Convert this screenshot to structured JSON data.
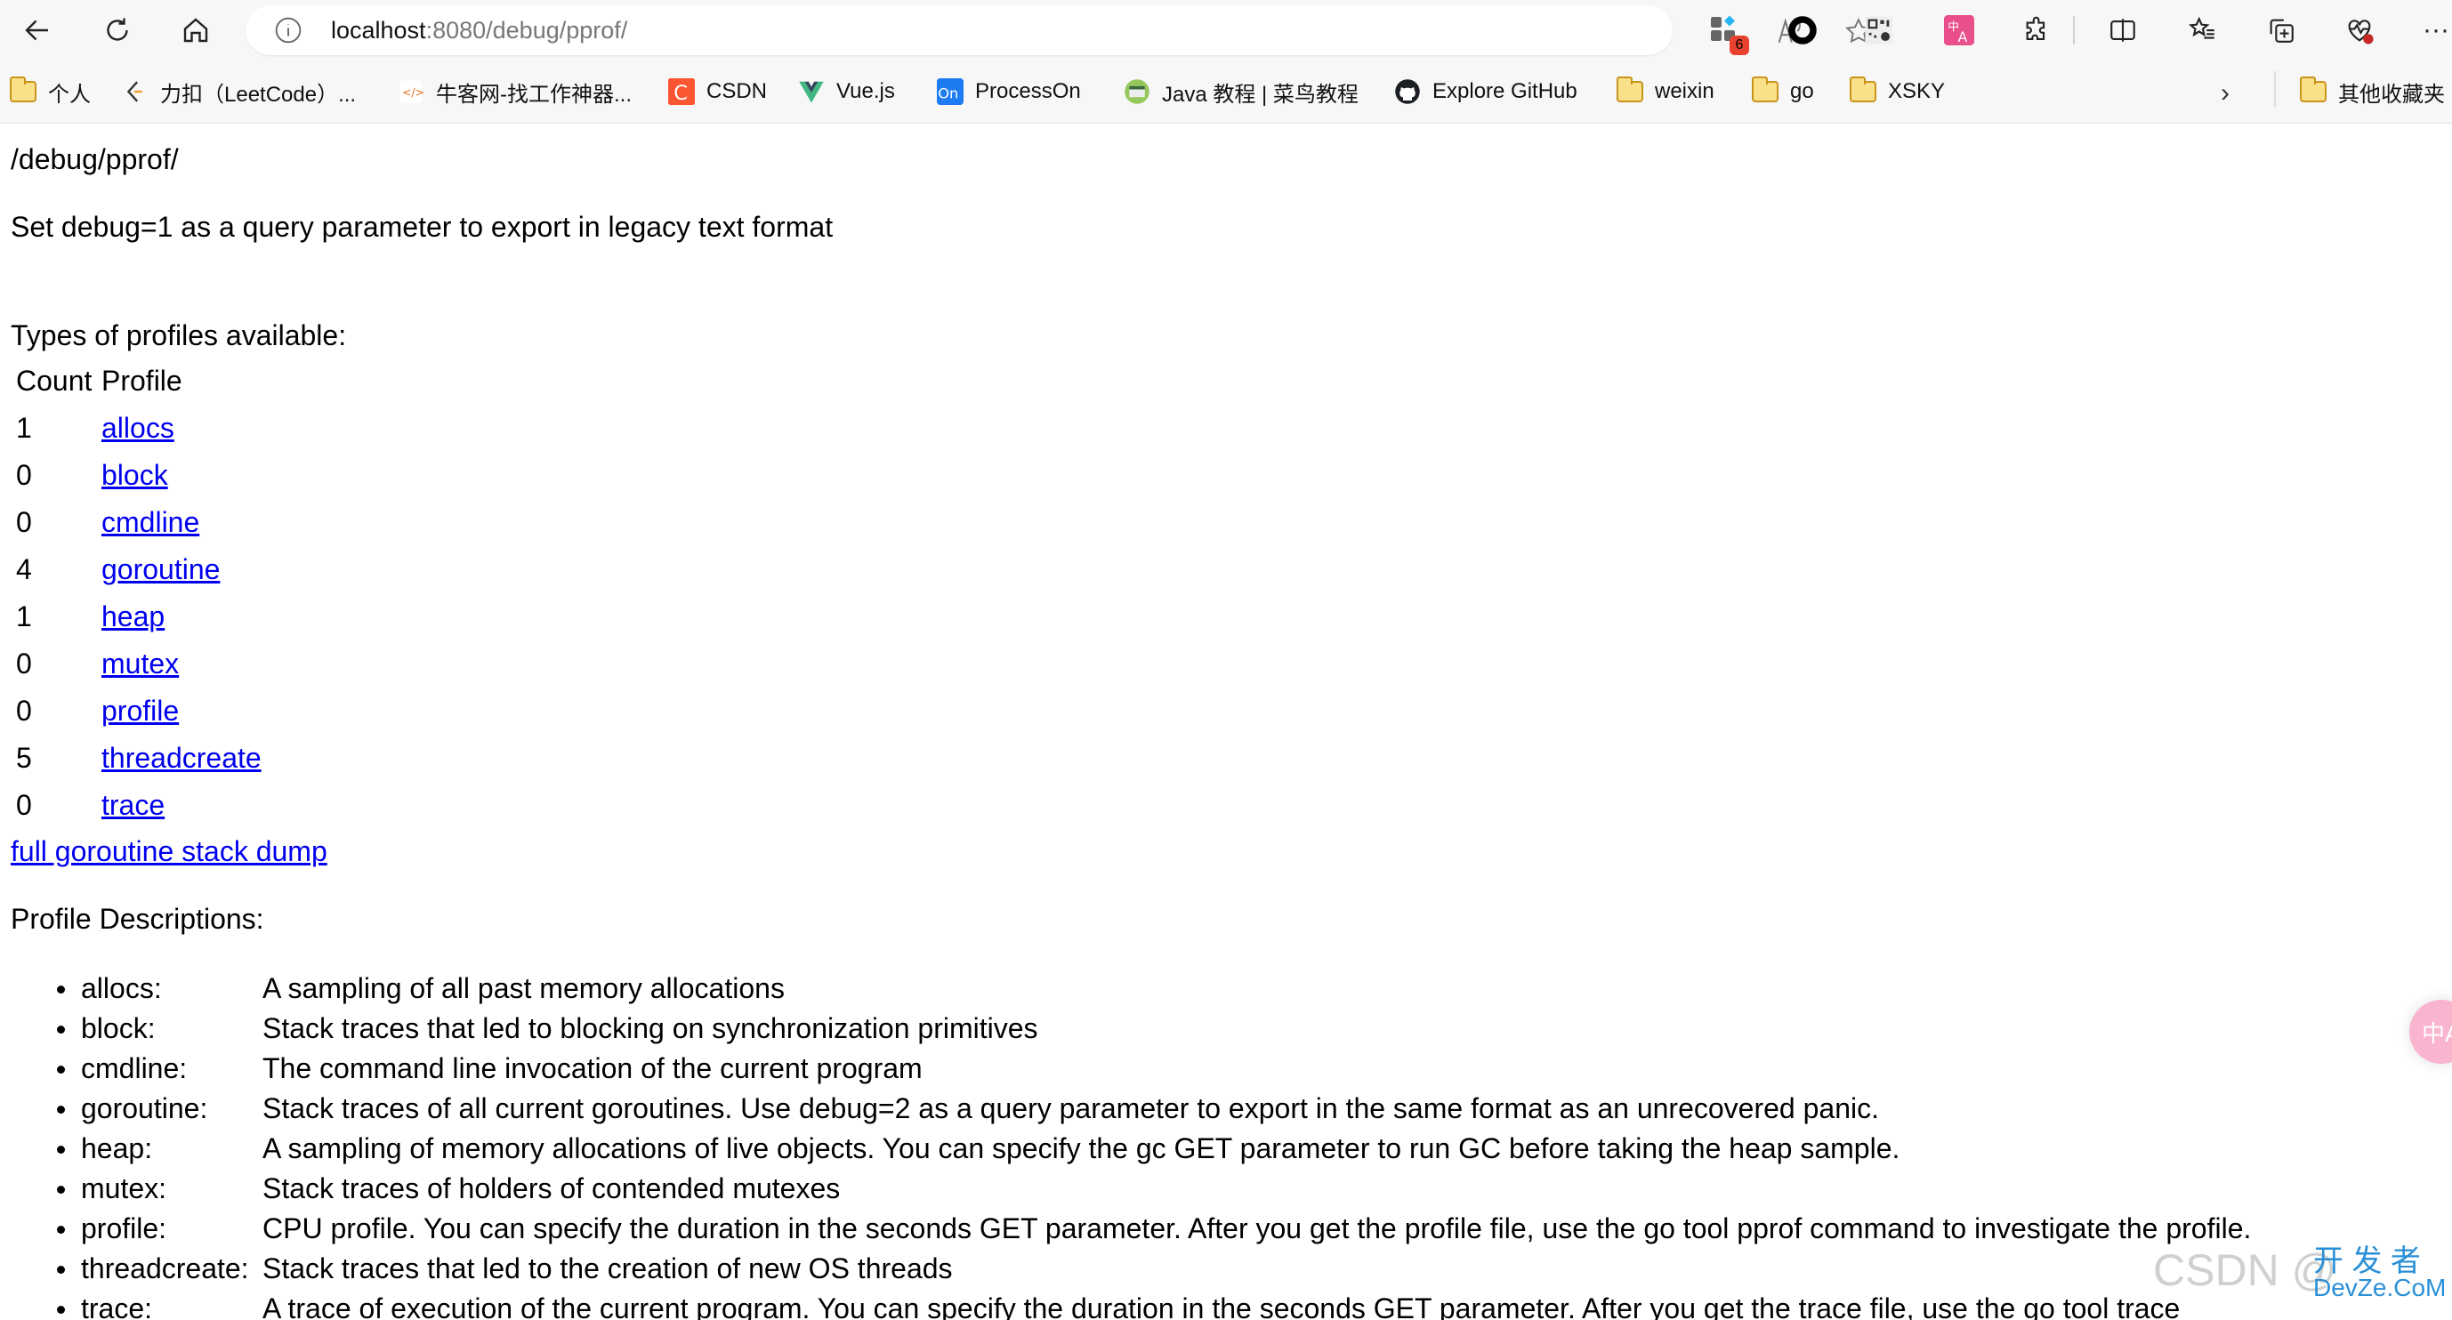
{
  "browser": {
    "url_host": "localhost",
    "url_rest": ":8080/debug/pprof/",
    "extension_badge_count": "6",
    "bookmarks": [
      {
        "label": "个人",
        "icon": "folder-icon"
      },
      {
        "label": "力扣（LeetCode）...",
        "icon": "leetcode-icon"
      },
      {
        "label": "牛客网-找工作神器...",
        "icon": "nowcoder-icon"
      },
      {
        "label": "CSDN",
        "icon": "csdn-icon"
      },
      {
        "label": "Vue.js",
        "icon": "vue-icon"
      },
      {
        "label": "ProcessOn",
        "icon": "processon-icon"
      },
      {
        "label": "Java 教程 | 菜鸟教程",
        "icon": "runoob-icon"
      },
      {
        "label": "Explore GitHub",
        "icon": "github-icon"
      },
      {
        "label": "weixin",
        "icon": "folder-icon"
      },
      {
        "label": "go",
        "icon": "folder-icon"
      },
      {
        "label": "XSKY",
        "icon": "folder-icon"
      }
    ],
    "other_bookmarks": "其他收藏夹",
    "accent_colors": {
      "link": "#0000ee",
      "badge": "#e8412e",
      "translate_ext": "#e94f8a",
      "folder": "#fbe08a"
    }
  },
  "page": {
    "path_title": "/debug/pprof/",
    "debug_hint": "Set debug=1 as a query parameter to export in legacy text format",
    "types_heading": "Types of profiles available:",
    "table_headers": {
      "count": "Count",
      "profile": "Profile"
    },
    "profiles": [
      {
        "count": "1",
        "name": "allocs"
      },
      {
        "count": "0",
        "name": "block"
      },
      {
        "count": "0",
        "name": "cmdline"
      },
      {
        "count": "4",
        "name": "goroutine"
      },
      {
        "count": "1",
        "name": "heap"
      },
      {
        "count": "0",
        "name": "mutex"
      },
      {
        "count": "0",
        "name": "profile"
      },
      {
        "count": "5",
        "name": "threadcreate"
      },
      {
        "count": "0",
        "name": "trace"
      }
    ],
    "full_dump_link": "full goroutine stack dump",
    "descriptions_heading": "Profile Descriptions:",
    "descriptions": [
      {
        "label": "allocs:",
        "text": "A sampling of all past memory allocations"
      },
      {
        "label": "block:",
        "text": "Stack traces that led to blocking on synchronization primitives"
      },
      {
        "label": "cmdline:",
        "text": "The command line invocation of the current program"
      },
      {
        "label": "goroutine:",
        "text": "Stack traces of all current goroutines. Use debug=2 as a query parameter to export in the same format as an unrecovered panic."
      },
      {
        "label": "heap:",
        "text": "A sampling of memory allocations of live objects. You can specify the gc GET parameter to run GC before taking the heap sample."
      },
      {
        "label": "mutex:",
        "text": "Stack traces of holders of contended mutexes"
      },
      {
        "label": "profile:",
        "text": "CPU profile. You can specify the duration in the seconds GET parameter. After you get the profile file, use the go tool pprof command to investigate the profile."
      },
      {
        "label": "threadcreate:",
        "text": "Stack traces that led to the creation of new OS threads"
      },
      {
        "label": "trace:",
        "text": "A trace of execution of the current program. You can specify the duration in the seconds GET parameter. After you get the trace file, use the go tool trace"
      }
    ]
  },
  "overlay": {
    "translate_float": "中A",
    "watermark_csdn": "CSDN @",
    "watermark_cn": "开 发 者",
    "watermark_en": "DevZe.CoM"
  }
}
